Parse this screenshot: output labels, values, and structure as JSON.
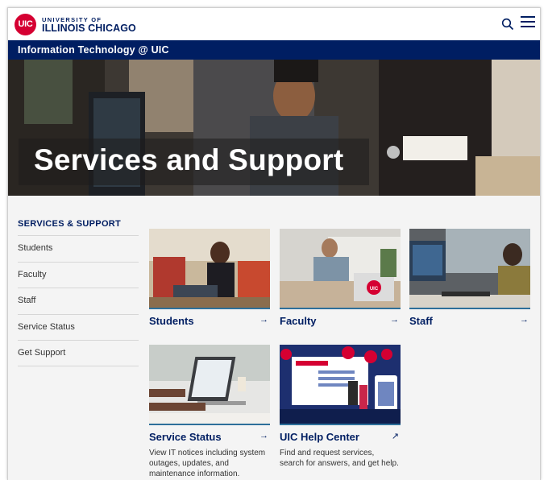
{
  "header": {
    "logo_badge": "UIC",
    "logo_line1": "UNIVERSITY OF",
    "logo_line2": "ILLINOIS CHICAGO",
    "search_icon": "search-icon",
    "menu_icon": "hamburger-menu-icon"
  },
  "site_bar": {
    "label": "Information Technology @ UIC"
  },
  "hero": {
    "title": "Services and Support"
  },
  "sidebar": {
    "heading": "SERVICES & SUPPORT",
    "items": [
      {
        "label": "Students"
      },
      {
        "label": "Faculty"
      },
      {
        "label": "Staff"
      },
      {
        "label": "Service Status"
      },
      {
        "label": "Get Support"
      }
    ]
  },
  "cards": [
    {
      "title": "Students",
      "arrow": "→",
      "description": ""
    },
    {
      "title": "Faculty",
      "arrow": "→",
      "description": ""
    },
    {
      "title": "Staff",
      "arrow": "→",
      "description": ""
    },
    {
      "title": "Service Status",
      "arrow": "→",
      "description": "View IT notices including system outages, updates, and maintenance information."
    },
    {
      "title": "UIC Help Center",
      "arrow": "↗",
      "description": "Find and request services, search for answers, and get help."
    }
  ],
  "colors": {
    "navy": "#001e62",
    "red": "#d50032",
    "accent_rule": "#2d6f9a"
  }
}
